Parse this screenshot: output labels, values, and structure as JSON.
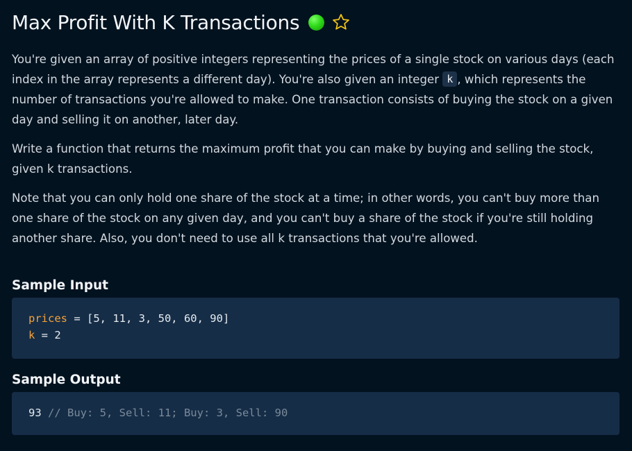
{
  "problem": {
    "title": "Max Profit With K Transactions",
    "difficulty_color": "#2fd91a",
    "star_icon": "star-outline-icon",
    "paragraph1_before": "You're given an array of positive integers representing the prices of a single stock on various days (each index in the array represents a different day). You're also given an integer ",
    "paragraph1_code": "k",
    "paragraph1_after": ", which represents the number of transactions you're allowed to make. One transaction consists of buying the stock on a given day and selling it on another, later day.",
    "paragraph2": "Write a function that returns the maximum profit that you can make by buying and selling the stock, given k transactions.",
    "paragraph3": "Note that you can only hold one share of the stock at a time; in other words, you can't buy more than one share of the stock on any given day, and you can't buy a share of the stock if you're still holding another share. Also, you don't need to use all k transactions that you're allowed."
  },
  "sample_input": {
    "heading": "Sample Input",
    "line1_var": "prices",
    "line1_rest": " = [5, 11, 3, 50, 60, 90]",
    "line2_var": "k",
    "line2_rest": " = 2"
  },
  "sample_output": {
    "heading": "Sample Output",
    "value": "93",
    "comment": " // Buy: 5, Sell: 11; Buy: 3, Sell: 90"
  },
  "colors": {
    "background": "#03121f",
    "code_background": "#162d47",
    "variable": "#f3a33b",
    "comment": "#7a8a9a",
    "star": "#f5c518"
  }
}
